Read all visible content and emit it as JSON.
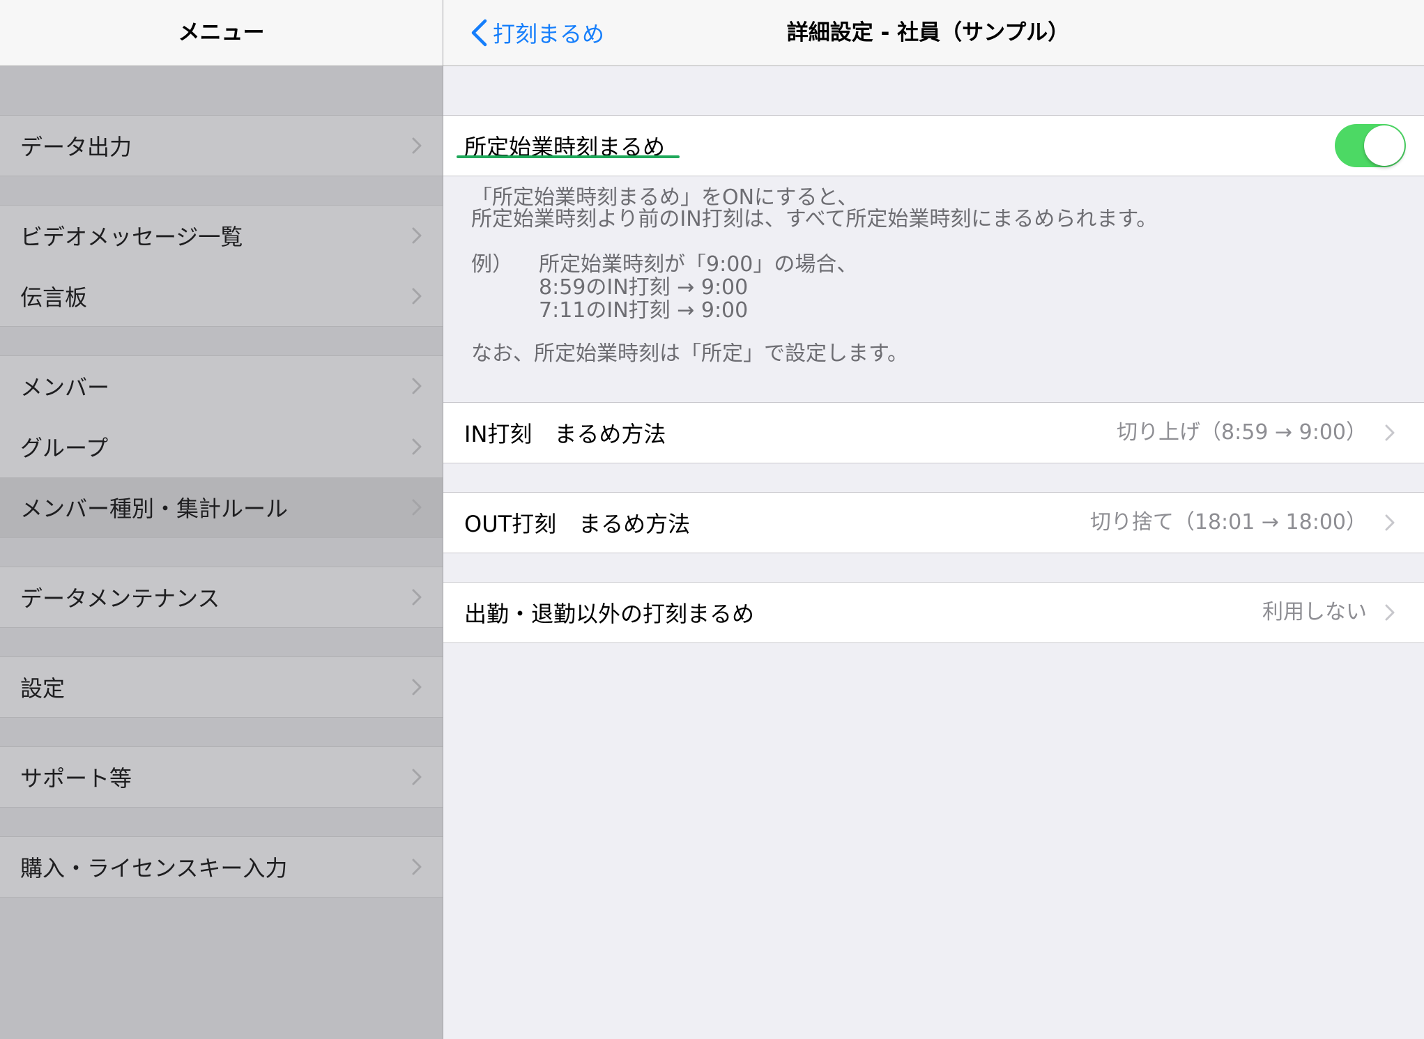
{
  "colors": {
    "accent": "#157efb",
    "toggle_on": "#4cd964",
    "annotation": "#1fa85a"
  },
  "icons": {
    "back": "chevron-left-icon",
    "disclosure": "chevron-right-icon"
  },
  "sidebar": {
    "title": "メニュー",
    "items": [
      {
        "label": "データ出力",
        "selected": false
      },
      {
        "label": "ビデオメッセージ一覧",
        "selected": false
      },
      {
        "label": "伝言板",
        "selected": false
      },
      {
        "label": "メンバー",
        "selected": false
      },
      {
        "label": "グループ",
        "selected": false
      },
      {
        "label": "メンバー種別・集計ルール",
        "selected": true
      },
      {
        "label": "データメンテナンス",
        "selected": false
      },
      {
        "label": "設定",
        "selected": false
      },
      {
        "label": "サポート等",
        "selected": false
      },
      {
        "label": "購入・ライセンスキー入力",
        "selected": false
      }
    ]
  },
  "detail": {
    "back_label": "打刻まるめ",
    "title": "詳細設定 - 社員（サンプル）",
    "start_rounding": {
      "label": "所定始業時刻まるめ",
      "enabled": true
    },
    "description": {
      "intro": "「所定始業時刻まるめ」をONにすると、",
      "rule": "所定始業時刻より前のIN打刻は、すべて所定始業時刻にまるめられます。",
      "example_label": "例）",
      "example_lines": [
        "所定始業時刻が「9:00」の場合、",
        "8:59のIN打刻 → 9:00",
        "7:11のIN打刻 → 9:00"
      ],
      "note": "なお、所定始業時刻は「所定」で設定します。"
    },
    "settings": [
      {
        "label": "IN打刻　まるめ方法",
        "value": "切り上げ（8:59 → 9:00）"
      },
      {
        "label": "OUT打刻　まるめ方法",
        "value": "切り捨て（18:01 → 18:00）"
      },
      {
        "label": "出勤・退勤以外の打刻まるめ",
        "value": "利用しない"
      }
    ]
  }
}
